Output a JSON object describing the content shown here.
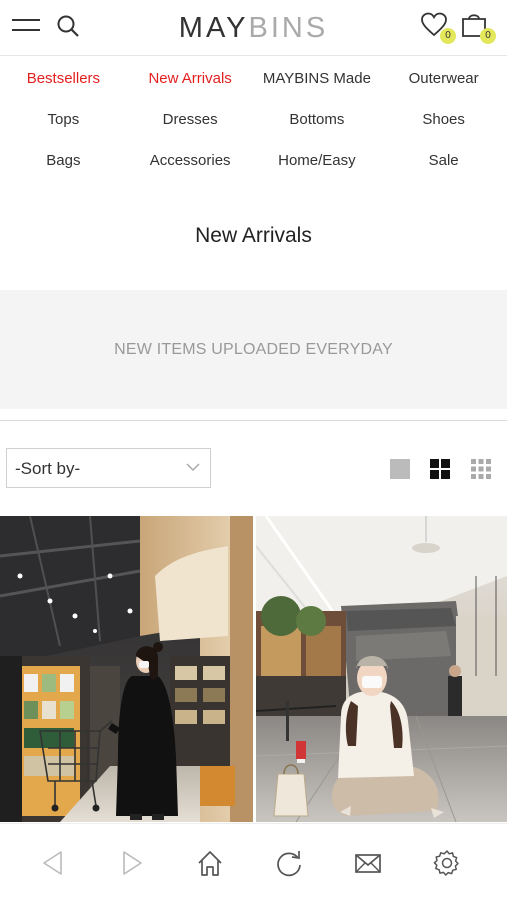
{
  "header": {
    "logo_dark": "MAY",
    "logo_light": "BINS",
    "wishlist_count": "0",
    "cart_count": "0",
    "icons": [
      "menu-icon",
      "search-icon",
      "heart-icon",
      "bag-icon"
    ]
  },
  "categories": [
    [
      {
        "label": "Bestsellers",
        "color": "#e32020"
      },
      {
        "label": "New Arrivals",
        "color": "#e32020"
      },
      {
        "label": "MAYBINS Made"
      },
      {
        "label": "Outerwear"
      }
    ],
    [
      {
        "label": "Tops"
      },
      {
        "label": "Dresses"
      },
      {
        "label": "Bottoms"
      },
      {
        "label": "Shoes"
      }
    ],
    [
      {
        "label": "Bags"
      },
      {
        "label": "Accessories"
      },
      {
        "label": "Home/Easy"
      },
      {
        "label": "Sale"
      }
    ]
  ],
  "page": {
    "title": "New Arrivals",
    "banner": "NEW ITEMS UPLOADED EVERYDAY"
  },
  "sort": {
    "selected": "-Sort by-"
  },
  "view_modes": [
    "single-view-icon",
    "grid-2-view-icon",
    "grid-3-view-icon"
  ],
  "products": [
    {
      "image": "woman-shopping-cart-photo"
    },
    {
      "image": "woman-sitting-mall-photo"
    }
  ],
  "bottom_bar": {
    "icons": [
      "back-icon",
      "forward-icon",
      "home-icon",
      "refresh-icon",
      "mail-icon",
      "settings-icon"
    ]
  },
  "colors": {
    "accent_red": "#e32020",
    "badge_yellow": "#e2e85a",
    "banner_bg": "#f4f4f4"
  }
}
